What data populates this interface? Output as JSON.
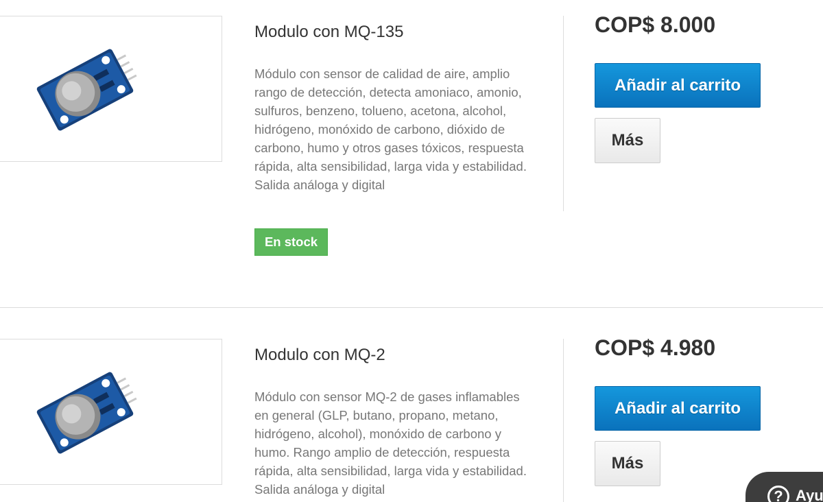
{
  "products": [
    {
      "title": "Modulo con MQ-135",
      "description": "Módulo con sensor de calidad de aire, amplio rango de detección, detecta amoniaco, amonio, sulfuros, benzeno, tolueno, acetona, alcohol, hidrógeno, monóxido de carbono, dióxido de carbono, humo y otros gases tóxicos, respuesta rápida, alta sensibilidad, larga vida y estabilidad. Salida análoga y digital",
      "stock_label": "En stock",
      "price": "COP$ 8.000",
      "add_to_cart_label": "Añadir al carrito",
      "more_label": "Más",
      "image_icon": "gas-sensor-module"
    },
    {
      "title": "Modulo con MQ-2",
      "description": "Módulo con sensor MQ-2 de gases inflamables en general (GLP, butano, propano, metano, hidrógeno, alcohol), monóxido de carbono y humo. Rango amplio de detección, respuesta rápida, alta sensibilidad, larga vida y estabilidad. Salida análoga y digital",
      "price": "COP$ 4.980",
      "add_to_cart_label": "Añadir al carrito",
      "more_label": "Más",
      "image_icon": "gas-sensor-module"
    }
  ],
  "help_widget": {
    "label": "Ayuda",
    "icon": "question-circle-icon"
  },
  "colors": {
    "primary_button": "#0a7fc9",
    "stock_badge": "#5cb85c",
    "help_widget_bg": "#3d3d3d"
  }
}
